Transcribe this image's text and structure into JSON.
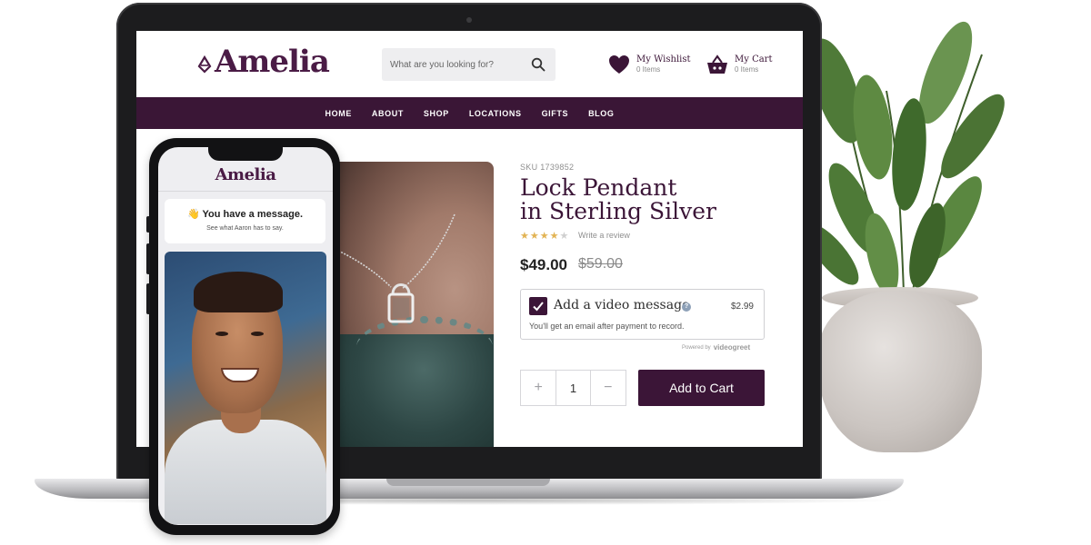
{
  "store": {
    "logo": "Amelia",
    "search_placeholder": "What are you looking for?",
    "wishlist": {
      "label": "My Wishlist",
      "count": "0 Items"
    },
    "cart": {
      "label": "My Cart",
      "count": "0 Items"
    },
    "nav": [
      "HOME",
      "ABOUT",
      "SHOP",
      "LOCATIONS",
      "GIFTS",
      "BLOG"
    ]
  },
  "product": {
    "sku": "SKU 1739852",
    "title_line1": "Lock Pendant",
    "title_line2": "in Sterling Silver",
    "rating": 4,
    "rating_max": 5,
    "write_review": "Write a review",
    "price": "$49.00",
    "old_price": "$59.00",
    "video_option": {
      "checked": true,
      "label": "Add a video message",
      "help": "?",
      "price": "$2.99",
      "subtext": "You'll get an email after payment to record.",
      "powered_by": "Powered by",
      "brand": "videogreet"
    },
    "quantity": "1",
    "decrement_label": "+",
    "increment_label": "−",
    "add_to_cart": "Add to Cart"
  },
  "phone": {
    "logo": "Amelia",
    "message_title": "👋 You have a message.",
    "message_sub": "See what Aaron has to say."
  },
  "colors": {
    "brand": "#3b1537",
    "star": "#e2b353"
  }
}
